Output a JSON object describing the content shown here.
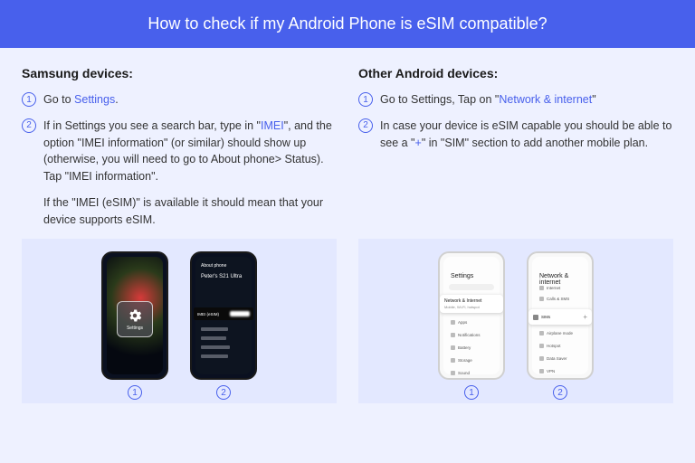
{
  "header": {
    "title": "How to check if my Android Phone is eSIM compatible?"
  },
  "samsung": {
    "title": "Samsung devices:",
    "step1_prefix": "Go to ",
    "step1_link": "Settings",
    "step1_suffix": ".",
    "step2_prefix": "If in Settings you see a search bar, type in \"",
    "step2_link": "IMEI",
    "step2_suffix": "\", and the option \"IMEI information\" (or similar) should show up (otherwise, you will need to go to About phone> Status). Tap \"IMEI information\".",
    "extra": "If the \"IMEI (eSIM)\" is available it should mean that your device supports eSIM.",
    "phone2_about": "About phone",
    "phone2_name": "Peter's S21 Ultra",
    "phone2_imei": "IMEI (eSIM)",
    "settings_label": "Settings"
  },
  "other": {
    "title": "Other Android devices:",
    "step1_prefix": "Go to Settings, Tap on \"",
    "step1_link": "Network & internet",
    "step1_suffix": "\"",
    "step2_prefix": "In case your device is eSIM capable you should be able to see a \"",
    "step2_link": "+",
    "step2_suffix": "\" in \"SIM\" section to add another mobile plan.",
    "phone1_title": "Settings",
    "phone1_card_title": "Network & Internet",
    "phone1_card_sub": "Mobile, Wi-Fi, hotspot",
    "phone2_title": "Network & internet",
    "phone2_sim": "SIMs"
  },
  "nums": {
    "1": "1",
    "2": "2"
  }
}
